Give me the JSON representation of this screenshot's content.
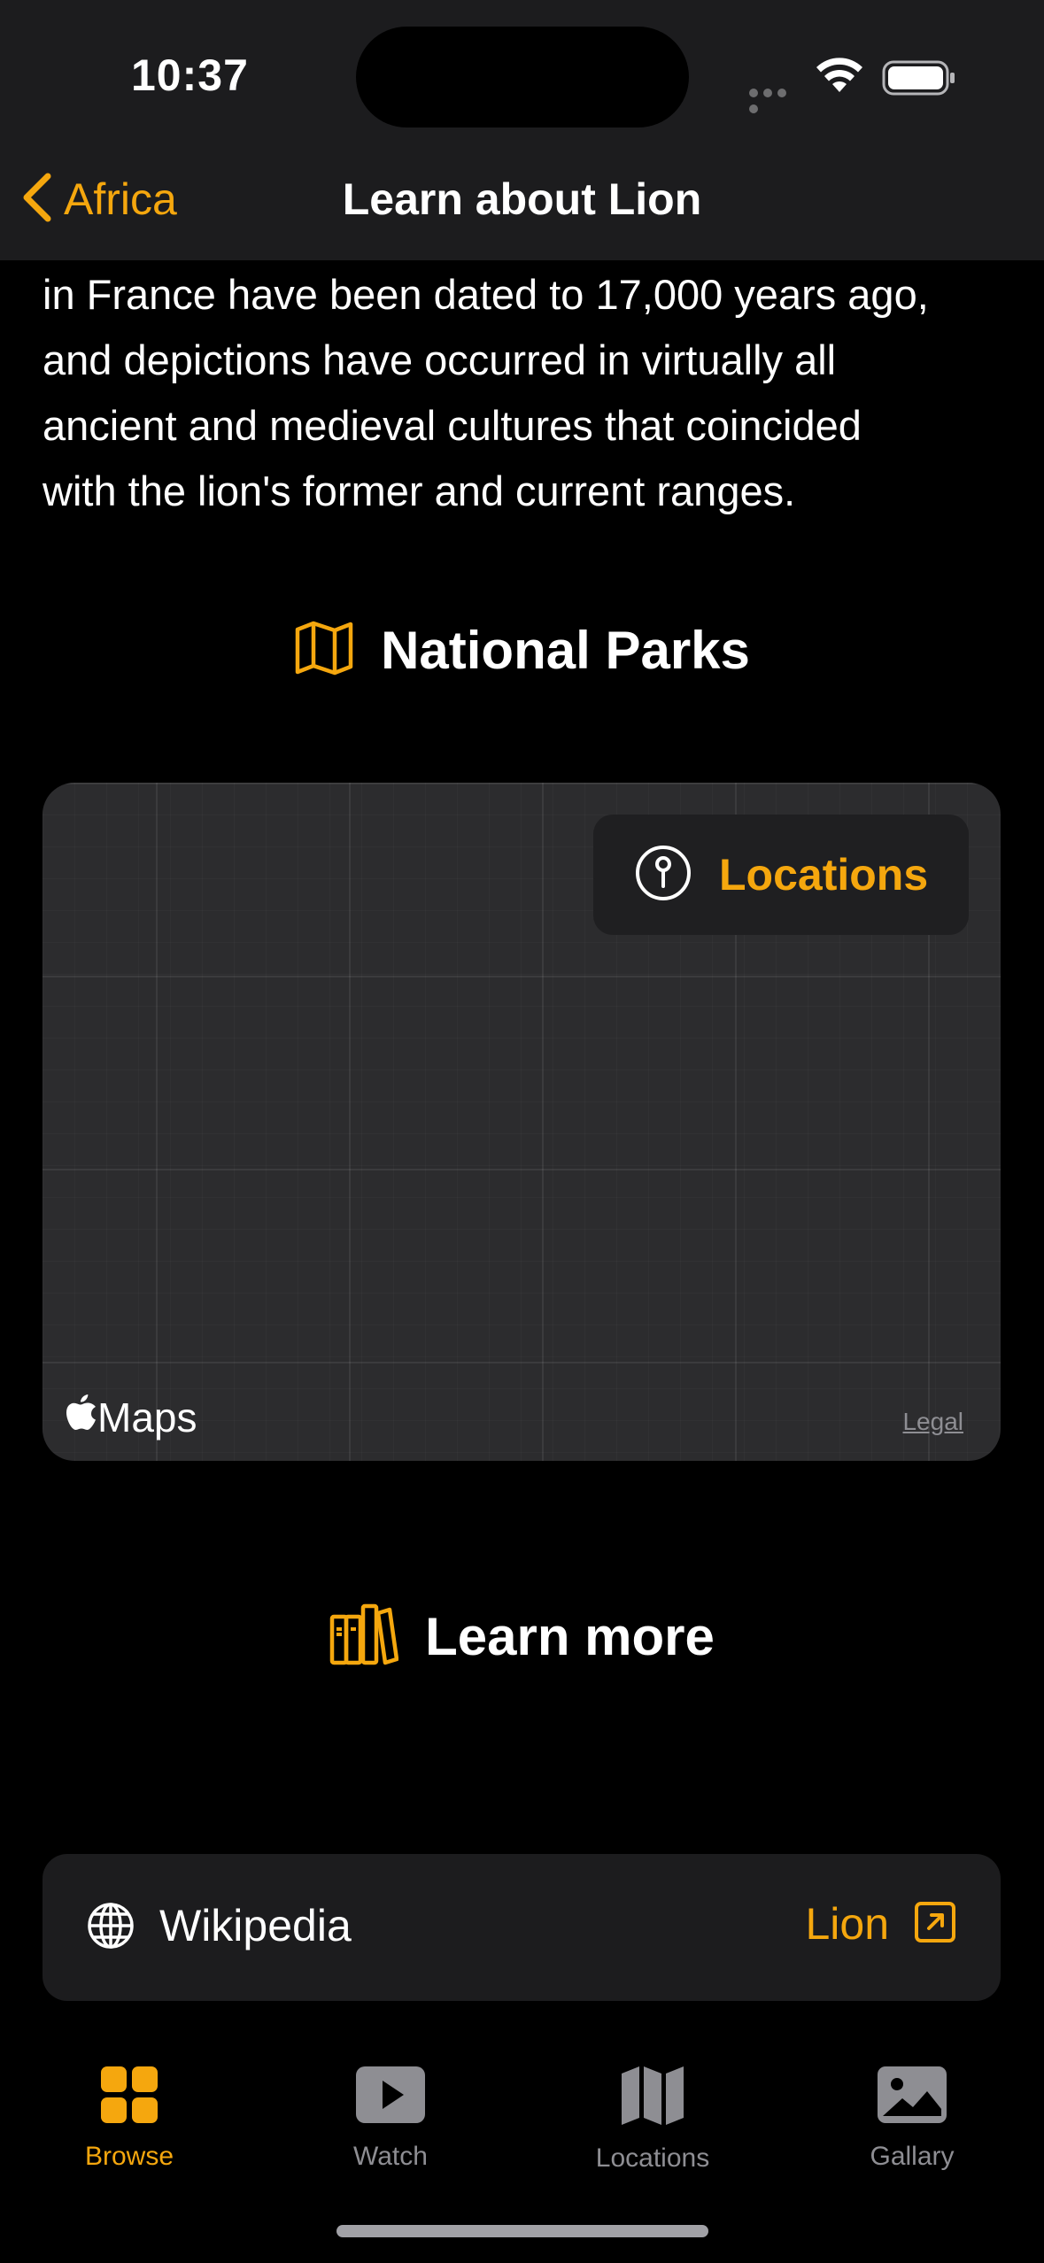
{
  "status_bar": {
    "time": "10:37"
  },
  "nav": {
    "back_label": "Africa",
    "title": "Learn about Lion"
  },
  "article": {
    "lines": [
      "in France have been dated to 17,000 years ago,",
      "and depictions have occurred in virtually all",
      "ancient and medieval cultures that coincided",
      "with the lion's former and current ranges."
    ]
  },
  "national_parks": {
    "heading": "National Parks",
    "icon": "map-icon"
  },
  "map": {
    "locations_button": "Locations",
    "provider": "Maps",
    "legal": "Legal"
  },
  "learn_more": {
    "heading": "Learn more",
    "icon": "books-icon"
  },
  "wiki": {
    "source": "Wikipedia",
    "link_label": "Lion"
  },
  "tabbar": {
    "items": [
      {
        "label": "Browse",
        "icon": "grid-icon",
        "active": true
      },
      {
        "label": "Watch",
        "icon": "play-icon",
        "active": false
      },
      {
        "label": "Locations",
        "icon": "map-icon",
        "active": false
      },
      {
        "label": "Gallary",
        "icon": "photo-icon",
        "active": false
      }
    ]
  },
  "colors": {
    "accent": "#f5a70e",
    "background": "#000000",
    "surface": "#1c1c1e",
    "map_surface": "#2c2c2e",
    "inactive_tab": "#8e8e93"
  }
}
